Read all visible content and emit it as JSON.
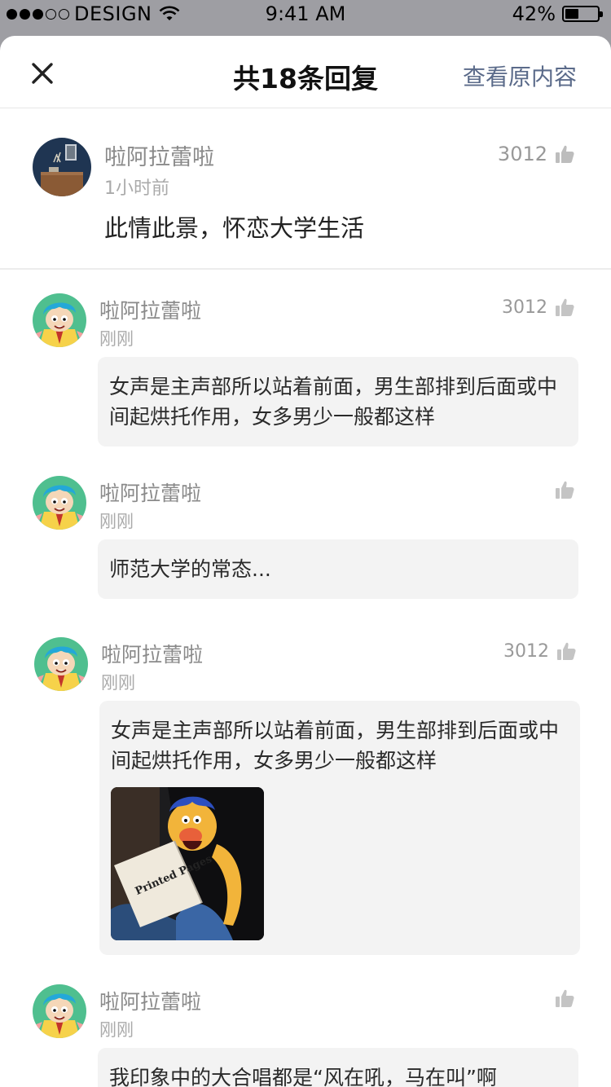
{
  "status_bar": {
    "carrier": "DESIGN",
    "time": "9:41 AM",
    "battery": "42%",
    "battery_level": 0.42
  },
  "nav": {
    "title": "共18条回复",
    "right_link": "查看原内容"
  },
  "main_comment": {
    "name": "啦阿拉蕾啦",
    "time": "1小时前",
    "text": "此情此景，怀恋大学生活",
    "likes": "3012"
  },
  "replies": [
    {
      "name": "啦阿拉蕾啦",
      "time": "刚刚",
      "likes": "3012",
      "text": "女声是主声部所以站着前面，男生部排到后面或中间起烘托作用，女多男少一般都这样"
    },
    {
      "name": "啦阿拉蕾啦",
      "time": "刚刚",
      "likes": "",
      "text": "师范大学的常态..."
    },
    {
      "name": "啦阿拉蕾啦",
      "time": "刚刚",
      "likes": "3012",
      "text": "女声是主声部所以站着前面，男生部排到后面或中间起烘托作用，女多男少一般都这样",
      "image_text": "Printed Pages"
    },
    {
      "name": "啦阿拉蕾啦",
      "time": "刚刚",
      "likes": "",
      "text": "我印象中的大合唱都是“风在吼，马在叫”啊"
    }
  ],
  "icons": {
    "close": "close-icon",
    "like": "thumbs-up-icon",
    "wifi": "wifi-icon",
    "battery": "battery-icon"
  }
}
